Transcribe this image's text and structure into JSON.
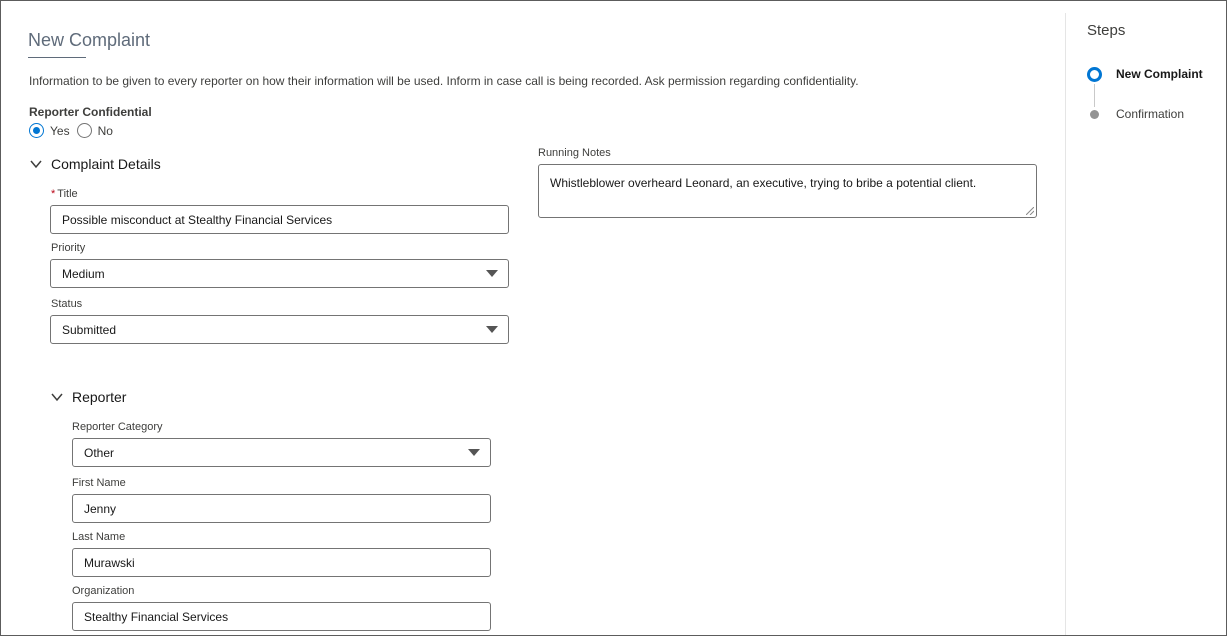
{
  "form": {
    "title": "New Complaint",
    "info_text": "Information to be given to every reporter on how their information will be used. Inform in case call is being recorded. Ask permission regarding confidentiality.",
    "confidential": {
      "label": "Reporter Confidential",
      "options": [
        "Yes",
        "No"
      ],
      "selected": "Yes"
    }
  },
  "complaint_details": {
    "section_label": "Complaint Details",
    "title": {
      "label": "Title",
      "required_marker": "*",
      "value": "Possible misconduct at Stealthy Financial Services"
    },
    "priority": {
      "label": "Priority",
      "value": "Medium"
    },
    "status": {
      "label": "Status",
      "value": "Submitted"
    },
    "running_notes": {
      "label": "Running Notes",
      "value": "Whistleblower overheard Leonard, an executive, trying to bribe a potential client."
    }
  },
  "reporter": {
    "section_label": "Reporter",
    "category": {
      "label": "Reporter Category",
      "value": "Other"
    },
    "first_name": {
      "label": "First Name",
      "value": "Jenny"
    },
    "last_name": {
      "label": "Last Name",
      "value": "Murawski"
    },
    "organization": {
      "label": "Organization",
      "value": "Stealthy Financial Services"
    }
  },
  "steps": {
    "title": "Steps",
    "items": [
      {
        "label": "New Complaint",
        "state": "active"
      },
      {
        "label": "Confirmation",
        "state": "pending"
      }
    ]
  },
  "colors": {
    "accent": "#0176d3",
    "border": "#747474",
    "required": "#ba0517"
  }
}
